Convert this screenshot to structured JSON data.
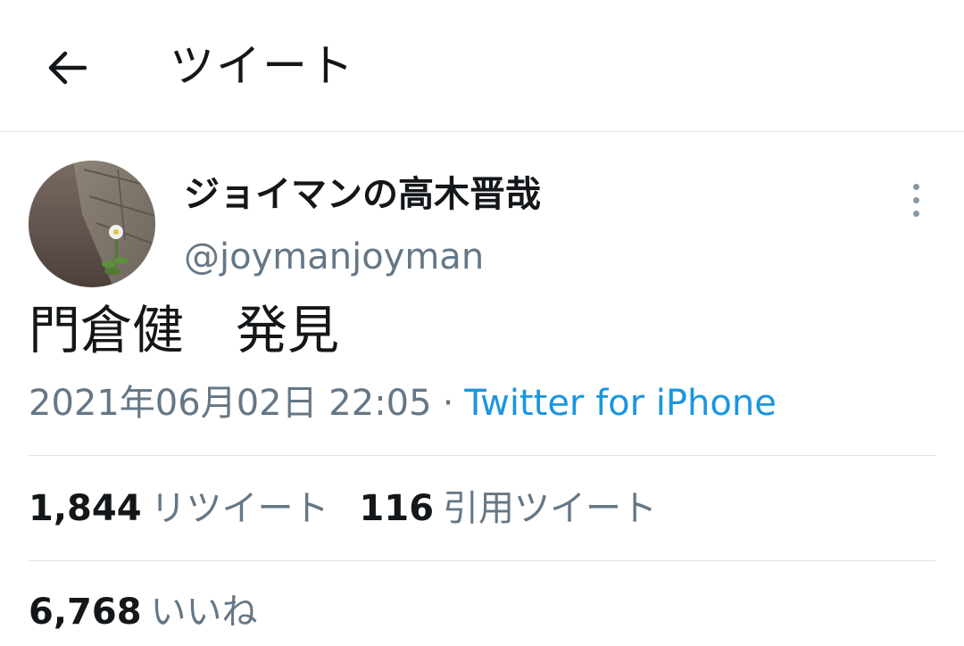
{
  "header": {
    "title": "ツイート",
    "back_icon": "arrow-left-icon"
  },
  "user": {
    "display_name": "ジョイマンの高木晋哉",
    "handle": "@joymanjoyman"
  },
  "tweet": {
    "text": "門倉健　発見",
    "timestamp": "2021年06月02日 22:05",
    "separator": "·",
    "source": "Twitter for iPhone"
  },
  "stats": {
    "retweets_count": "1,844",
    "retweets_label": "リツイート",
    "quotes_count": "116",
    "quotes_label": "引用ツイート",
    "likes_count": "6,768",
    "likes_label": "いいね"
  },
  "colors": {
    "text": "#14171a",
    "secondary": "#657786",
    "link": "#1b95e0",
    "border": "#dfe3e6"
  }
}
